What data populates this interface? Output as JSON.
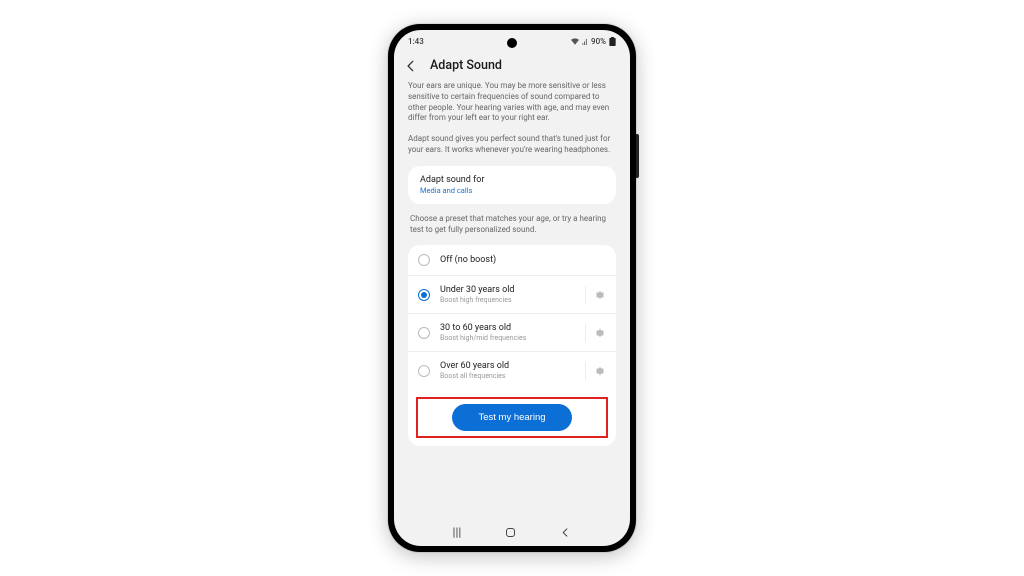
{
  "status": {
    "time": "1:43",
    "battery": "90%"
  },
  "header": {
    "title": "Adapt Sound"
  },
  "desc1": "Your ears are unique. You may be more sensitive or less sensitive to certain frequencies of sound compared to other people. Your hearing varies with age, and may even differ from your left ear to your right ear.",
  "desc2": "Adapt sound gives you perfect sound that's tuned just for your ears. It works whenever you're wearing headphones.",
  "adapt_for": {
    "title": "Adapt sound for",
    "value": "Media and calls"
  },
  "instruction": "Choose a preset that matches your age, or try a hearing test to get fully personalized sound.",
  "options": [
    {
      "label": "Off (no boost)",
      "sub": "",
      "selected": false,
      "gear": false
    },
    {
      "label": "Under 30 years old",
      "sub": "Boost high frequencies",
      "selected": true,
      "gear": true
    },
    {
      "label": "30 to 60 years old",
      "sub": "Boost high/mid frequencies",
      "selected": false,
      "gear": true
    },
    {
      "label": "Over 60 years old",
      "sub": "Boost all frequencies",
      "selected": false,
      "gear": true
    }
  ],
  "test_button": "Test my hearing"
}
